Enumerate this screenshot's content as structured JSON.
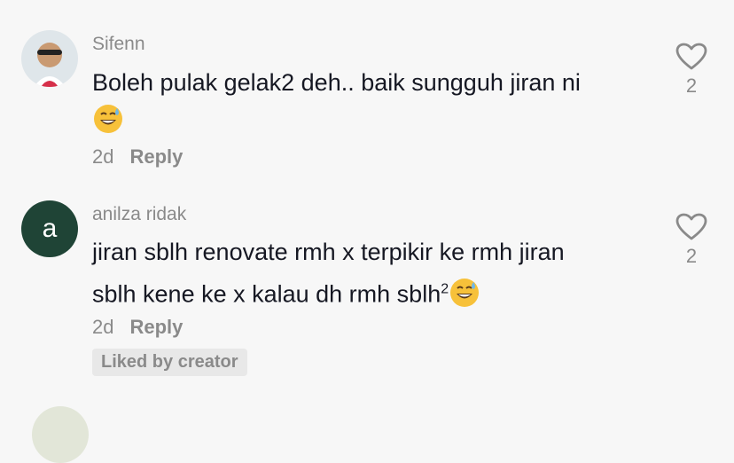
{
  "comments": [
    {
      "username": "Sifenn",
      "text_line1": "Boleh pulak gelak2 deh.. baik sungguh jiran ni",
      "time": "2d",
      "reply": "Reply",
      "likes": "2"
    },
    {
      "avatar_letter": "a",
      "username": "anilza ridak",
      "text_line1": "jiran sblh renovate rmh x terpikir ke rmh jiran",
      "text_line2": "sblh kene ke x kalau dh rmh sblh",
      "text_sup": "2",
      "time": "2d",
      "reply": "Reply",
      "likes": "2",
      "badge": "Liked by creator"
    }
  ],
  "icons": {
    "like": "heart-outline-icon",
    "emoji": "grinning-sweat-emoji"
  },
  "colors": {
    "avatar_bg": "#1f4436",
    "muted": "#8a8a8a",
    "text": "#161823"
  }
}
